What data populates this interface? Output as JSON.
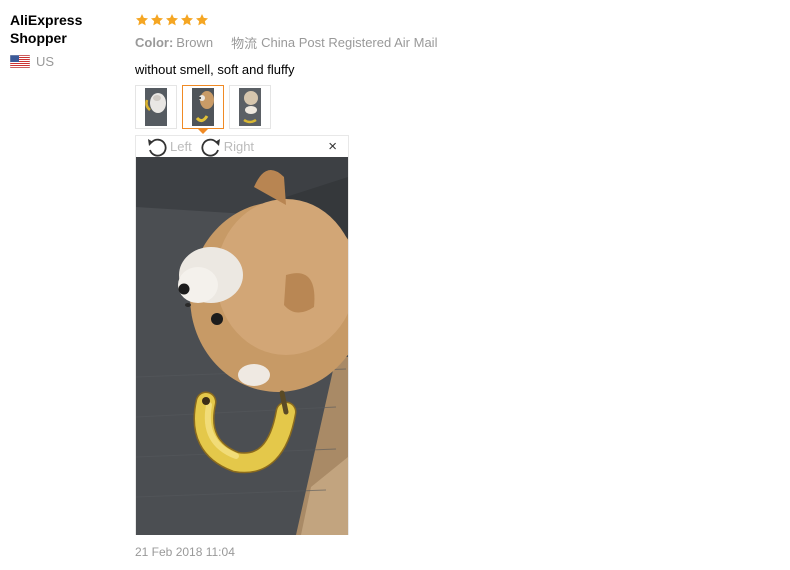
{
  "reviewer": {
    "name": "AliExpress Shopper",
    "country": "US"
  },
  "review": {
    "rating": 5,
    "rating_max": 5,
    "color_label": "Color:",
    "color_value": "Brown",
    "shipping_label": "物流",
    "shipping_value": "China Post Registered Air Mail",
    "text": "without smell, soft and fluffy",
    "date": "21 Feb 2018 11:04"
  },
  "viewer": {
    "rotate_left": "Left",
    "rotate_right": "Right",
    "close": "×",
    "selected_index": 1
  },
  "colors": {
    "star": "#f5a623",
    "accent": "#f08a24"
  }
}
